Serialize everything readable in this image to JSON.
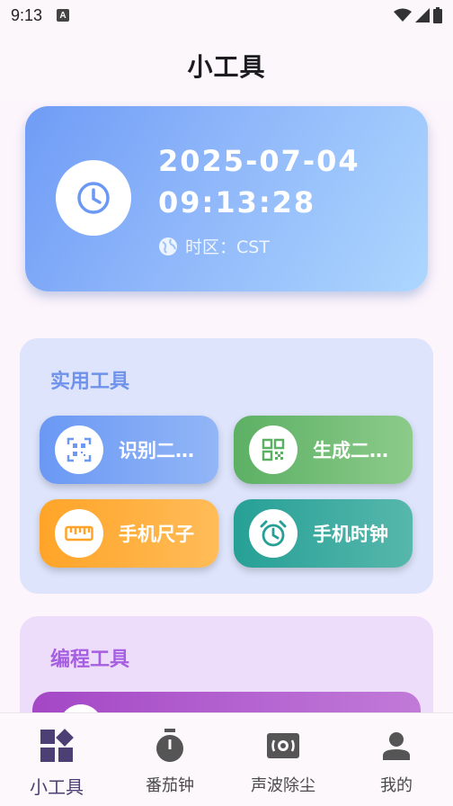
{
  "status": {
    "time": "9:13",
    "notification_glyph": "A"
  },
  "appbar": {
    "title": "小工具"
  },
  "clock": {
    "date": "2025-07-04",
    "time": "09:13:28",
    "timezone": "时区：CST"
  },
  "sections": {
    "utility": {
      "title": "实用工具",
      "tools": [
        {
          "label": "识别二…",
          "icon": "qr-scan-icon"
        },
        {
          "label": "生成二…",
          "icon": "qr-code-icon"
        },
        {
          "label": "手机尺子",
          "icon": "ruler-icon"
        },
        {
          "label": "手机时钟",
          "icon": "alarm-clock-icon"
        }
      ]
    },
    "programming": {
      "title": "编程工具"
    }
  },
  "nav": {
    "items": [
      {
        "label": "小工具",
        "icon": "widgets-icon",
        "active": true
      },
      {
        "label": "番茄钟",
        "icon": "timer-icon",
        "active": false
      },
      {
        "label": "声波除尘",
        "icon": "speaker-icon",
        "active": false
      },
      {
        "label": "我的",
        "icon": "person-icon",
        "active": false
      }
    ]
  },
  "colors": {
    "accent_blue": "#6f92ea",
    "accent_purple": "#a65fe0",
    "nav_active": "#4b3f74"
  }
}
